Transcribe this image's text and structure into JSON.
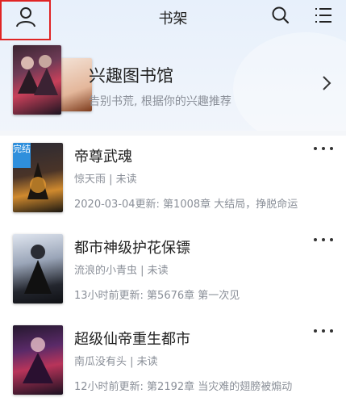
{
  "header": {
    "title": "书架",
    "icons": [
      "user-icon",
      "search-icon",
      "menu-list-icon"
    ]
  },
  "interest": {
    "title": "兴趣图书馆",
    "subtitle": "告别书荒, 根据你的兴趣推荐"
  },
  "books": [
    {
      "name": "帝尊武魂",
      "author": "惊天雨",
      "status": "未读",
      "update": "2020-03-04更新: 第1008章 大结局，挣脱命运",
      "badge": "完结"
    },
    {
      "name": "都市神级护花保镖",
      "author": "流浪的小青虫",
      "status": "未读",
      "update": "13小时前更新: 第5676章 第一次见"
    },
    {
      "name": "超级仙帝重生都市",
      "author": "南瓜没有头",
      "status": "未读",
      "update": "12小时前更新: 第2192章 当灾难的翅膀被煽动"
    }
  ],
  "colors": {
    "accent_blue": "#2f8fdc",
    "highlight_red": "#e02424",
    "muted_text": "#8a8f98"
  }
}
